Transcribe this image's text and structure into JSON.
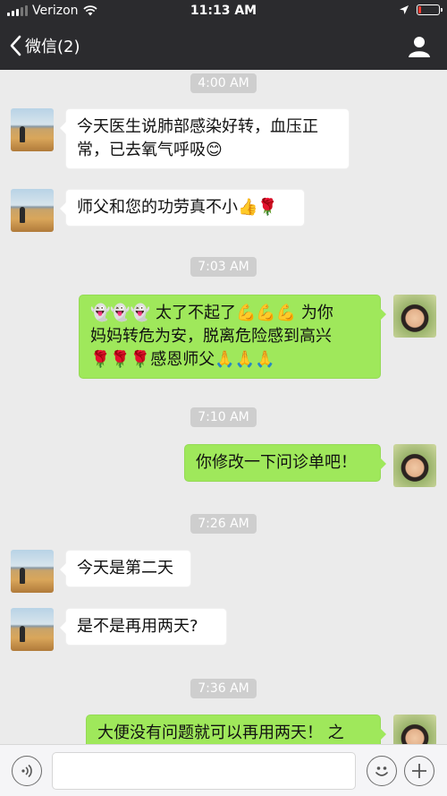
{
  "status_bar": {
    "carrier": "Verizon",
    "time": "11:13 AM",
    "battery_level": 0.12,
    "battery_color": "#ff3b30"
  },
  "nav": {
    "back_label": "微信(2)",
    "profile_icon": "person-icon"
  },
  "timestamps": [
    "4:00 AM",
    "7:03 AM",
    "7:10 AM",
    "7:26 AM",
    "7:36 AM"
  ],
  "messages": [
    {
      "side": "incoming",
      "lines": [
        "今天医生说肺部感染好转，血压正",
        "常，已去氧气呼吸😊"
      ]
    },
    {
      "side": "incoming",
      "lines": [
        "师父和您的功劳真不小👍🌹"
      ]
    },
    {
      "side": "outgoing",
      "lines": [
        "👻👻👻 太了不起了💪💪💪 为你",
        "妈妈转危为安，脱离危险感到高兴",
        "🌹🌹🌹感恩师父🙏🙏🙏"
      ]
    },
    {
      "side": "outgoing",
      "lines": [
        "你修改一下问诊单吧！"
      ]
    },
    {
      "side": "incoming",
      "lines": [
        "今天是第二天"
      ]
    },
    {
      "side": "incoming",
      "lines": [
        "是不是再用两天?"
      ]
    },
    {
      "side": "outgoing",
      "lines": [
        "大便没有问题就可以再用两天！ 之"
      ]
    }
  ],
  "input_bar": {
    "voice_icon": "voice-icon",
    "emoji_icon": "emoji-icon",
    "add_icon": "plus-icon",
    "input_value": ""
  },
  "colors": {
    "header_bg": "#2b2b2e",
    "chat_bg": "#ebebeb",
    "outgoing_bubble": "#9fe85b",
    "incoming_bubble": "#ffffff",
    "timestamp_bg": "#cecece"
  }
}
